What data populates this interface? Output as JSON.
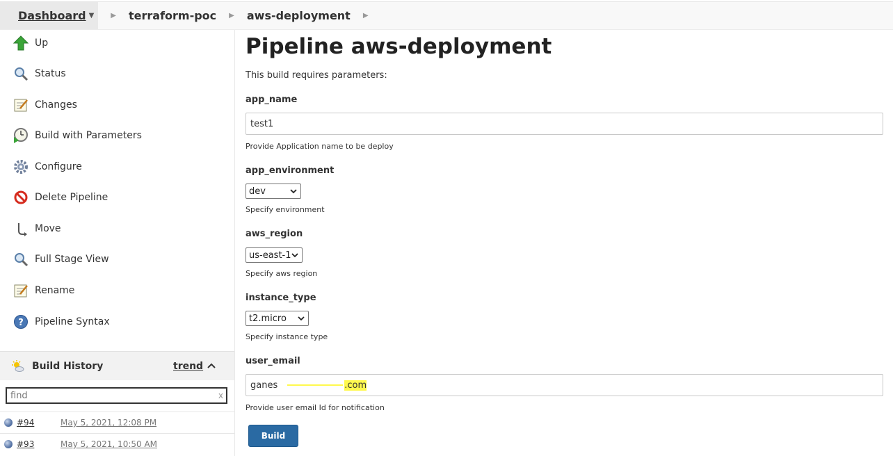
{
  "breadcrumb": {
    "items": [
      "Dashboard",
      "terraform-poc",
      "aws-deployment"
    ]
  },
  "sidebar": {
    "items": [
      {
        "label": "Up",
        "icon": "up-arrow-icon"
      },
      {
        "label": "Status",
        "icon": "magnifier-icon"
      },
      {
        "label": "Changes",
        "icon": "notepad-icon"
      },
      {
        "label": "Build with Parameters",
        "icon": "clock-play-icon"
      },
      {
        "label": "Configure",
        "icon": "gear-icon"
      },
      {
        "label": "Delete Pipeline",
        "icon": "no-entry-icon"
      },
      {
        "label": "Move",
        "icon": "move-icon"
      },
      {
        "label": "Full Stage View",
        "icon": "magnifier-icon"
      },
      {
        "label": "Rename",
        "icon": "notepad-icon"
      },
      {
        "label": "Pipeline Syntax",
        "icon": "help-icon"
      }
    ],
    "build_history": {
      "title": "Build History",
      "trend": "trend",
      "find_placeholder": "find",
      "find_clear": "x",
      "builds": [
        {
          "number": "#94",
          "date": "May 5, 2021, 12:08 PM"
        },
        {
          "number": "#93",
          "date": "May 5, 2021, 10:50 AM"
        }
      ]
    }
  },
  "main": {
    "title": "Pipeline aws-deployment",
    "intro": "This build requires parameters:",
    "params": {
      "app_name": {
        "label": "app_name",
        "value": "test1",
        "desc": "Provide Application name to be deploy"
      },
      "app_environment": {
        "label": "app_environment",
        "value": "dev",
        "desc": "Specify environment"
      },
      "aws_region": {
        "label": "aws_region",
        "value": "us-east-1",
        "desc": "Specify aws region"
      },
      "instance_type": {
        "label": "instance_type",
        "value": "t2.micro",
        "desc": "Specify instance type"
      },
      "user_email": {
        "label": "user_email",
        "value_prefix": "ganes",
        "value_suffix": ".com",
        "desc": "Provide user email Id for notification"
      }
    },
    "build_button": "Build"
  },
  "colors": {
    "build_button": "#2a6aa3",
    "highlight": "#fff94d",
    "breadcrumb_bg": "#f8f8f8"
  }
}
